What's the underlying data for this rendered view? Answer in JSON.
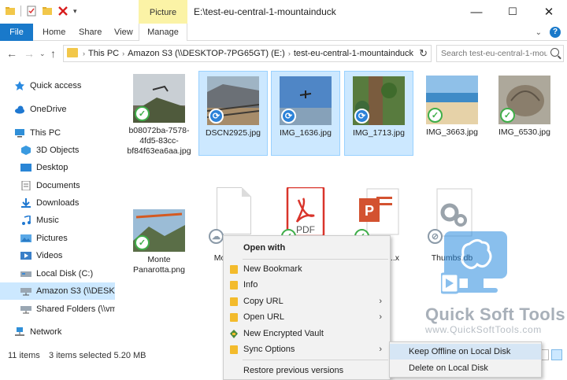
{
  "window": {
    "title": "E:\\test-eu-central-1-mountainduck",
    "context_tab": "Picture Tools",
    "minimize": "—",
    "maximize": "☐",
    "close": "✕"
  },
  "ribbon": {
    "tabs": [
      "File",
      "Home",
      "Share",
      "View",
      "Manage"
    ],
    "file_color": "#1979ca",
    "context_color": "#fbf3a6"
  },
  "address": {
    "crumbs": [
      "This PC",
      "Amazon S3 (\\\\DESKTOP-7PG65GT) (E:)",
      "test-eu-central-1-mountainduck"
    ],
    "search_placeholder": "Search test-eu-central-1-mou..."
  },
  "nav": {
    "items": [
      {
        "label": "Quick access",
        "icon": "star-icon"
      },
      {
        "label": "OneDrive",
        "icon": "cloud-icon"
      },
      {
        "label": "This PC",
        "icon": "computer-icon"
      },
      {
        "label": "3D Objects",
        "icon": "cube-icon"
      },
      {
        "label": "Desktop",
        "icon": "desktop-icon"
      },
      {
        "label": "Documents",
        "icon": "document-icon"
      },
      {
        "label": "Downloads",
        "icon": "download-icon"
      },
      {
        "label": "Music",
        "icon": "music-icon"
      },
      {
        "label": "Pictures",
        "icon": "pictures-icon"
      },
      {
        "label": "Videos",
        "icon": "video-icon"
      },
      {
        "label": "Local Disk (C:)",
        "icon": "disk-icon"
      },
      {
        "label": "Amazon S3 (\\\\DESKTOP-7",
        "icon": "network-drive-icon"
      },
      {
        "label": "Shared Folders (\\\\vmware",
        "icon": "network-drive-icon"
      },
      {
        "label": "Network",
        "icon": "network-icon"
      }
    ],
    "selected_index": 11
  },
  "files": [
    {
      "name": "b08072ba-7578-4fd5-83cc-bf84f63ea6aa.jpg",
      "badge": "synced"
    },
    {
      "name": "DSCN2925.jpg",
      "badge": "syncing"
    },
    {
      "name": "IMG_1636.jpg",
      "badge": "syncing"
    },
    {
      "name": "IMG_1713.jpg",
      "badge": "syncing"
    },
    {
      "name": "IMG_3663.jpg",
      "badge": "synced"
    },
    {
      "name": "IMG_6530.jpg",
      "badge": "synced"
    },
    {
      "name": "Monte Panarotta.png",
      "badge": "synced"
    },
    {
      "name": "Mo... Du...",
      "badge": "online"
    },
    {
      "name": "",
      "badge": "synced"
    },
    {
      "name": "...x",
      "badge": "synced"
    },
    {
      "name": "Thumbs.db",
      "badge": "unsynced"
    }
  ],
  "pdf_label": "PDF",
  "status": {
    "count": "11 items",
    "selected": "3 items selected  5.20 MB"
  },
  "context_menu": {
    "header": "Open with",
    "items": [
      {
        "label": "New Bookmark",
        "submenu": false
      },
      {
        "label": "Info",
        "submenu": false
      },
      {
        "label": "Copy URL",
        "submenu": true
      },
      {
        "label": "Open URL",
        "submenu": true
      },
      {
        "label": "New Encrypted Vault",
        "submenu": false
      },
      {
        "label": "Sync Options",
        "submenu": true
      },
      {
        "label": "Restore previous versions",
        "submenu": false
      }
    ],
    "submenu": [
      "Keep Offline on Local Disk",
      "Delete on Local Disk"
    ]
  },
  "watermark": {
    "name": "Quick Soft Tools",
    "url": "www.QuickSoftTools.com"
  }
}
